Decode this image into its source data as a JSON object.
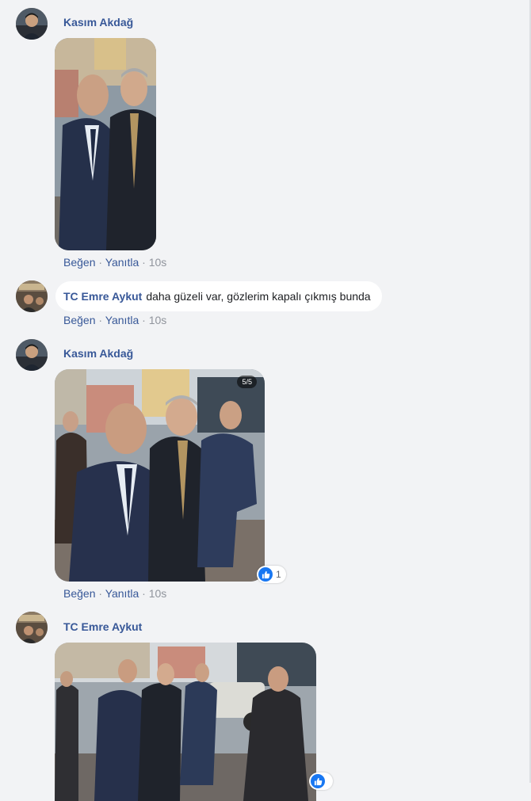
{
  "comments": [
    {
      "author": "Kasım Akdağ",
      "like": "Beğen",
      "reply": "Yanıtla",
      "time": "10s"
    },
    {
      "author": "TC Emre Aykut",
      "text": "daha güzeli var, gözlerim kapalı çıkmış bunda",
      "like": "Beğen",
      "reply": "Yanıtla",
      "time": "10s"
    },
    {
      "author": "Kasım Akdağ",
      "photo_counter": "5/5",
      "reaction_count": "1",
      "like": "Beğen",
      "reply": "Yanıtla",
      "time": "10s"
    },
    {
      "author": "TC Emre Aykut"
    }
  ],
  "separator": " · ",
  "colors": {
    "link": "#385898",
    "muted": "#90949c",
    "background": "#f2f3f5",
    "like_blue": "#1877f2"
  }
}
